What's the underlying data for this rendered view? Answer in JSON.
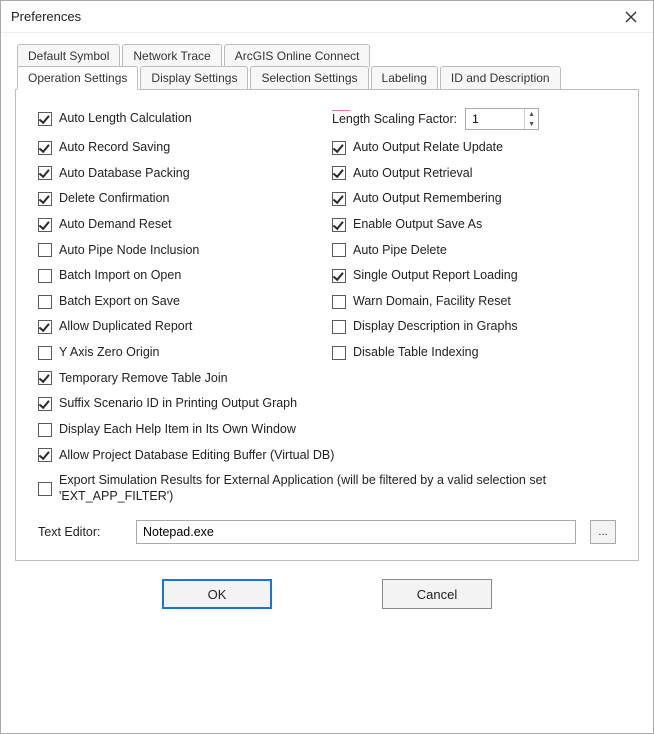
{
  "window": {
    "title": "Preferences"
  },
  "tabs": {
    "row1": [
      {
        "label": "Default Symbol"
      },
      {
        "label": "Network Trace"
      },
      {
        "label": "ArcGIS Online Connect"
      }
    ],
    "row2": [
      {
        "label": "Operation Settings",
        "active": true
      },
      {
        "label": "Display Settings"
      },
      {
        "label": "Selection Settings"
      },
      {
        "label": "Labeling"
      },
      {
        "label": "ID and Description"
      }
    ]
  },
  "left": [
    {
      "label": "Auto Length Calculation",
      "checked": true
    },
    {
      "label": "Auto Record Saving",
      "checked": true
    },
    {
      "label": "Auto Database Packing",
      "checked": true
    },
    {
      "label": "Delete Confirmation",
      "checked": true
    },
    {
      "label": "Auto Demand Reset",
      "checked": true
    },
    {
      "label": "Auto Pipe Node Inclusion",
      "checked": false
    },
    {
      "label": "Batch Import on Open",
      "checked": false
    },
    {
      "label": "Batch Export on Save",
      "checked": false
    },
    {
      "label": "Allow Duplicated Report",
      "checked": true
    },
    {
      "label": "Y Axis Zero Origin",
      "checked": false
    }
  ],
  "right_first": {
    "label": "Length Scaling Factor:",
    "value": "1"
  },
  "right": [
    {
      "label": "Auto Output Relate Update",
      "checked": true
    },
    {
      "label": "Auto Output Retrieval",
      "checked": true
    },
    {
      "label": "Auto Output Remembering",
      "checked": true
    },
    {
      "label": "Enable Output Save As",
      "checked": true
    },
    {
      "label": "Auto Pipe Delete",
      "checked": false
    },
    {
      "label": "Single Output Report Loading",
      "checked": true
    },
    {
      "label": "Warn Domain, Facility Reset",
      "checked": false
    },
    {
      "label": "Display Description in Graphs",
      "checked": false
    },
    {
      "label": "Disable Table Indexing",
      "checked": false
    }
  ],
  "full": [
    {
      "label": "Temporary Remove Table Join",
      "checked": true
    },
    {
      "label": "Suffix Scenario ID in Printing Output Graph",
      "checked": true
    },
    {
      "label": "Display Each Help Item in Its Own Window",
      "checked": false
    },
    {
      "label": "Allow Project Database Editing Buffer (Virtual DB)",
      "checked": true
    },
    {
      "label": "Export Simulation Results for External Application (will be filtered by a valid selection set 'EXT_APP_FILTER')",
      "checked": false
    }
  ],
  "text_editor": {
    "label": "Text Editor:",
    "value": "Notepad.exe",
    "browse": "..."
  },
  "buttons": {
    "ok": "OK",
    "cancel": "Cancel"
  }
}
